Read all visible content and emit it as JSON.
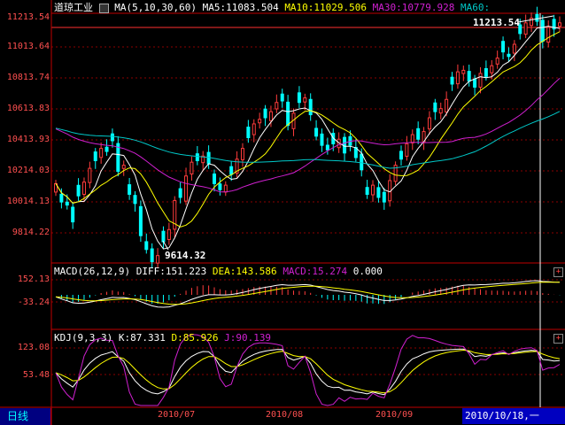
{
  "main_header": {
    "name": "道琼工业",
    "ma_spec": "MA(5,10,30,60)",
    "ma5": "MA5:11083.504",
    "ma10": "MA10:11029.506",
    "ma30": "MA30:10779.928",
    "ma60": "MA60:"
  },
  "macd_header": {
    "spec": "MACD(26,12,9)",
    "diff": "DIFF:151.223",
    "dea": "DEA:143.586",
    "macd": "MACD:15.274",
    "zero": "0.000"
  },
  "kdj_header": {
    "spec": "KDJ(9,3,3)",
    "k": "K:87.331",
    "d": "D:85.926",
    "j": "J:90.139"
  },
  "price_axis": [
    "11213.54",
    "11013.64",
    "10813.74",
    "10613.83",
    "10413.93",
    "10214.03",
    "10014.13",
    "9814.22"
  ],
  "macd_axis": [
    "152.13",
    "-33.24"
  ],
  "kdj_axis": [
    "123.08",
    "53.48"
  ],
  "annotations": {
    "high": "11213.54",
    "low": "9614.32"
  },
  "period_button": "日线",
  "x_axis": [
    "2010/07",
    "2010/08",
    "2010/09"
  ],
  "cursor_date": "2010/10/18,一",
  "colors": {
    "up": "#ff3c3c",
    "down": "#00ffff",
    "ma5": "#ffffff",
    "ma10": "#ffff00",
    "ma30": "#d020d0",
    "ma60": "#00c8c8",
    "grid": "#8b0000",
    "frame": "#c00000"
  },
  "chart_data": {
    "type": "candlestick",
    "price_series": {
      "close": [
        10130,
        10010,
        9990,
        9880,
        10050,
        10140,
        10230,
        10280,
        10360,
        10340,
        10410,
        10210,
        10250,
        10060,
        10000,
        9790,
        9700,
        9620,
        9660,
        9750,
        9830,
        10020,
        10040,
        10180,
        10270,
        10280,
        10310,
        10260,
        10130,
        10090,
        10120,
        10190,
        10290,
        10360,
        10430,
        10520,
        10550,
        10560,
        10600,
        10660,
        10670,
        10510,
        10590,
        10660,
        10690,
        10580,
        10440,
        10380,
        10350,
        10390,
        10420,
        10330,
        10380,
        10300,
        10220,
        10060,
        10120,
        10040,
        10010,
        10150,
        10250,
        10290,
        10390,
        10450,
        10420,
        10470,
        10560,
        10600,
        10620,
        10680,
        10780,
        10860,
        10870,
        10800,
        10760,
        10850,
        10830,
        10900,
        10950,
        10990,
        10960,
        11040,
        11110,
        11180,
        11210,
        11190,
        11060,
        11150,
        11140,
        11180
      ],
      "ma5_last": 11083.504,
      "ma10_last": 11029.506,
      "ma30_last": 10779.928,
      "visible_high": 11213.54,
      "visible_low": 9614.32
    },
    "macd": {
      "diff": 151.223,
      "dea": 143.586,
      "macd": 15.274
    },
    "kdj": {
      "k": 87.331,
      "d": 85.926,
      "j": 90.139
    },
    "x_ticks": [
      "2010/07",
      "2010/08",
      "2010/09"
    ]
  }
}
